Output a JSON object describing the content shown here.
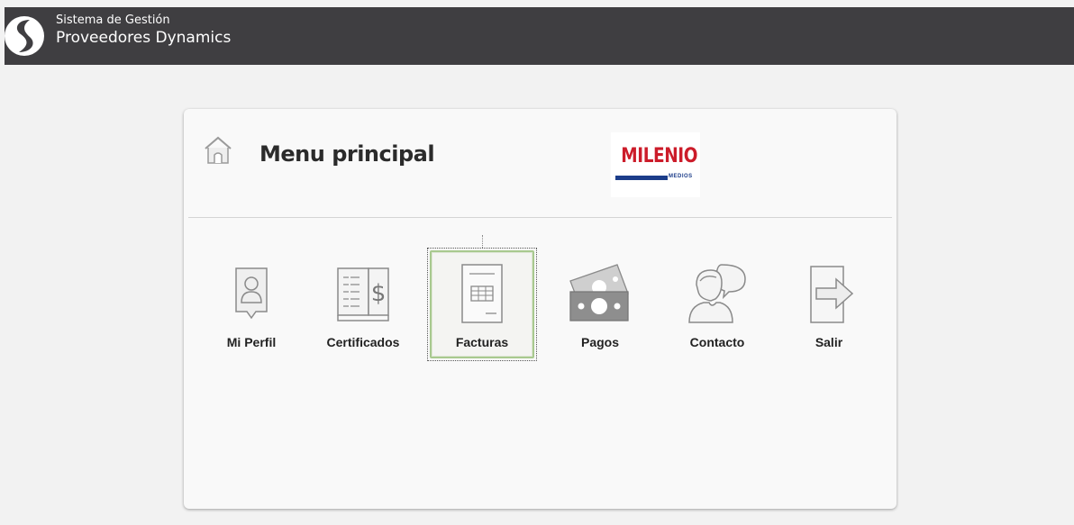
{
  "header": {
    "line1": "Sistema de Gestión",
    "line2": "Proveedores Dynamics",
    "background": "#3f3e41"
  },
  "card": {
    "title": "Menu principal",
    "home_icon": "home-icon",
    "brand": {
      "name": "MILENIO",
      "sub": "MEDIOS",
      "red": "#cc1c2a",
      "blue": "#1c3d8a"
    }
  },
  "menu": [
    {
      "label": "Mi Perfil",
      "icon": "profile-icon"
    },
    {
      "label": "Certificados",
      "icon": "certificates-book-icon"
    },
    {
      "label": "Facturas",
      "icon": "invoice-icon",
      "selected": true
    },
    {
      "label": "Pagos",
      "icon": "money-icon"
    },
    {
      "label": "Contacto",
      "icon": "contact-speech-icon"
    },
    {
      "label": "Salir",
      "icon": "exit-arrow-icon"
    }
  ],
  "colors": {
    "background": "#f2f2f2",
    "card": "#f9f9f9",
    "selected_border": "#a8c98f",
    "icon_gray": "#8a8a8a"
  }
}
